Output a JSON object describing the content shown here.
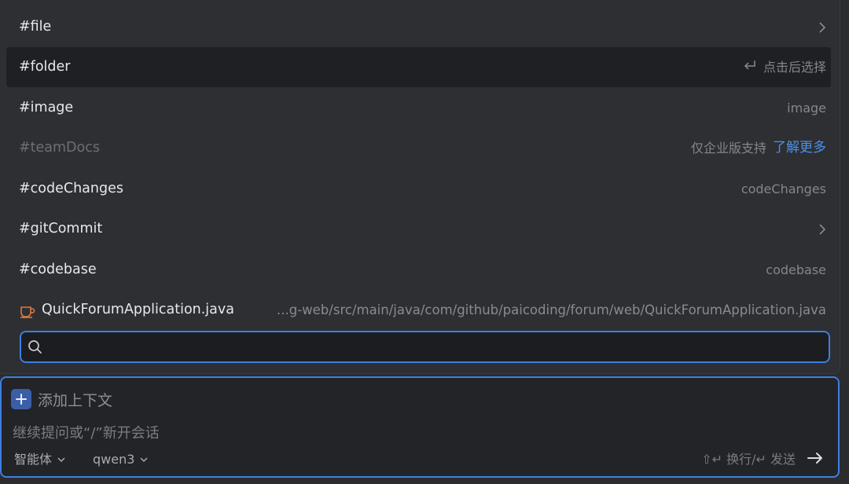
{
  "menu": {
    "items": [
      {
        "label": "#file",
        "right_text": "",
        "right_icon": "chevron-right-icon"
      },
      {
        "label": "#folder",
        "right_text": "点击后选择",
        "right_icon": "enter-key-icon"
      },
      {
        "label": "#image",
        "right_text": "image"
      },
      {
        "label": "#teamDocs",
        "right_text": "仅企业版支持",
        "link_text": "了解更多"
      },
      {
        "label": "#codeChanges",
        "right_text": "codeChanges"
      },
      {
        "label": "#gitCommit",
        "right_text": "",
        "right_icon": "chevron-right-icon"
      },
      {
        "label": "#codebase",
        "right_text": "codebase"
      },
      {
        "label": "QuickForumApplication.java",
        "right_text": "...g-web/src/main/java/com/github/paicoding/forum/web/QuickForumApplication.java",
        "icon": "java-coffee-icon"
      }
    ]
  },
  "search": {
    "placeholder": "",
    "value": ""
  },
  "chat": {
    "add_context_label": "添加上下文",
    "placeholder": "继续提问或“/”新开会话",
    "mode_label": "智能体",
    "model_label": "qwen3",
    "hint": "⇧↵ 换行/↵ 发送"
  },
  "colors": {
    "accent": "#3d7fe0",
    "link": "#4a90e8",
    "java_icon": "#e07a3a"
  }
}
